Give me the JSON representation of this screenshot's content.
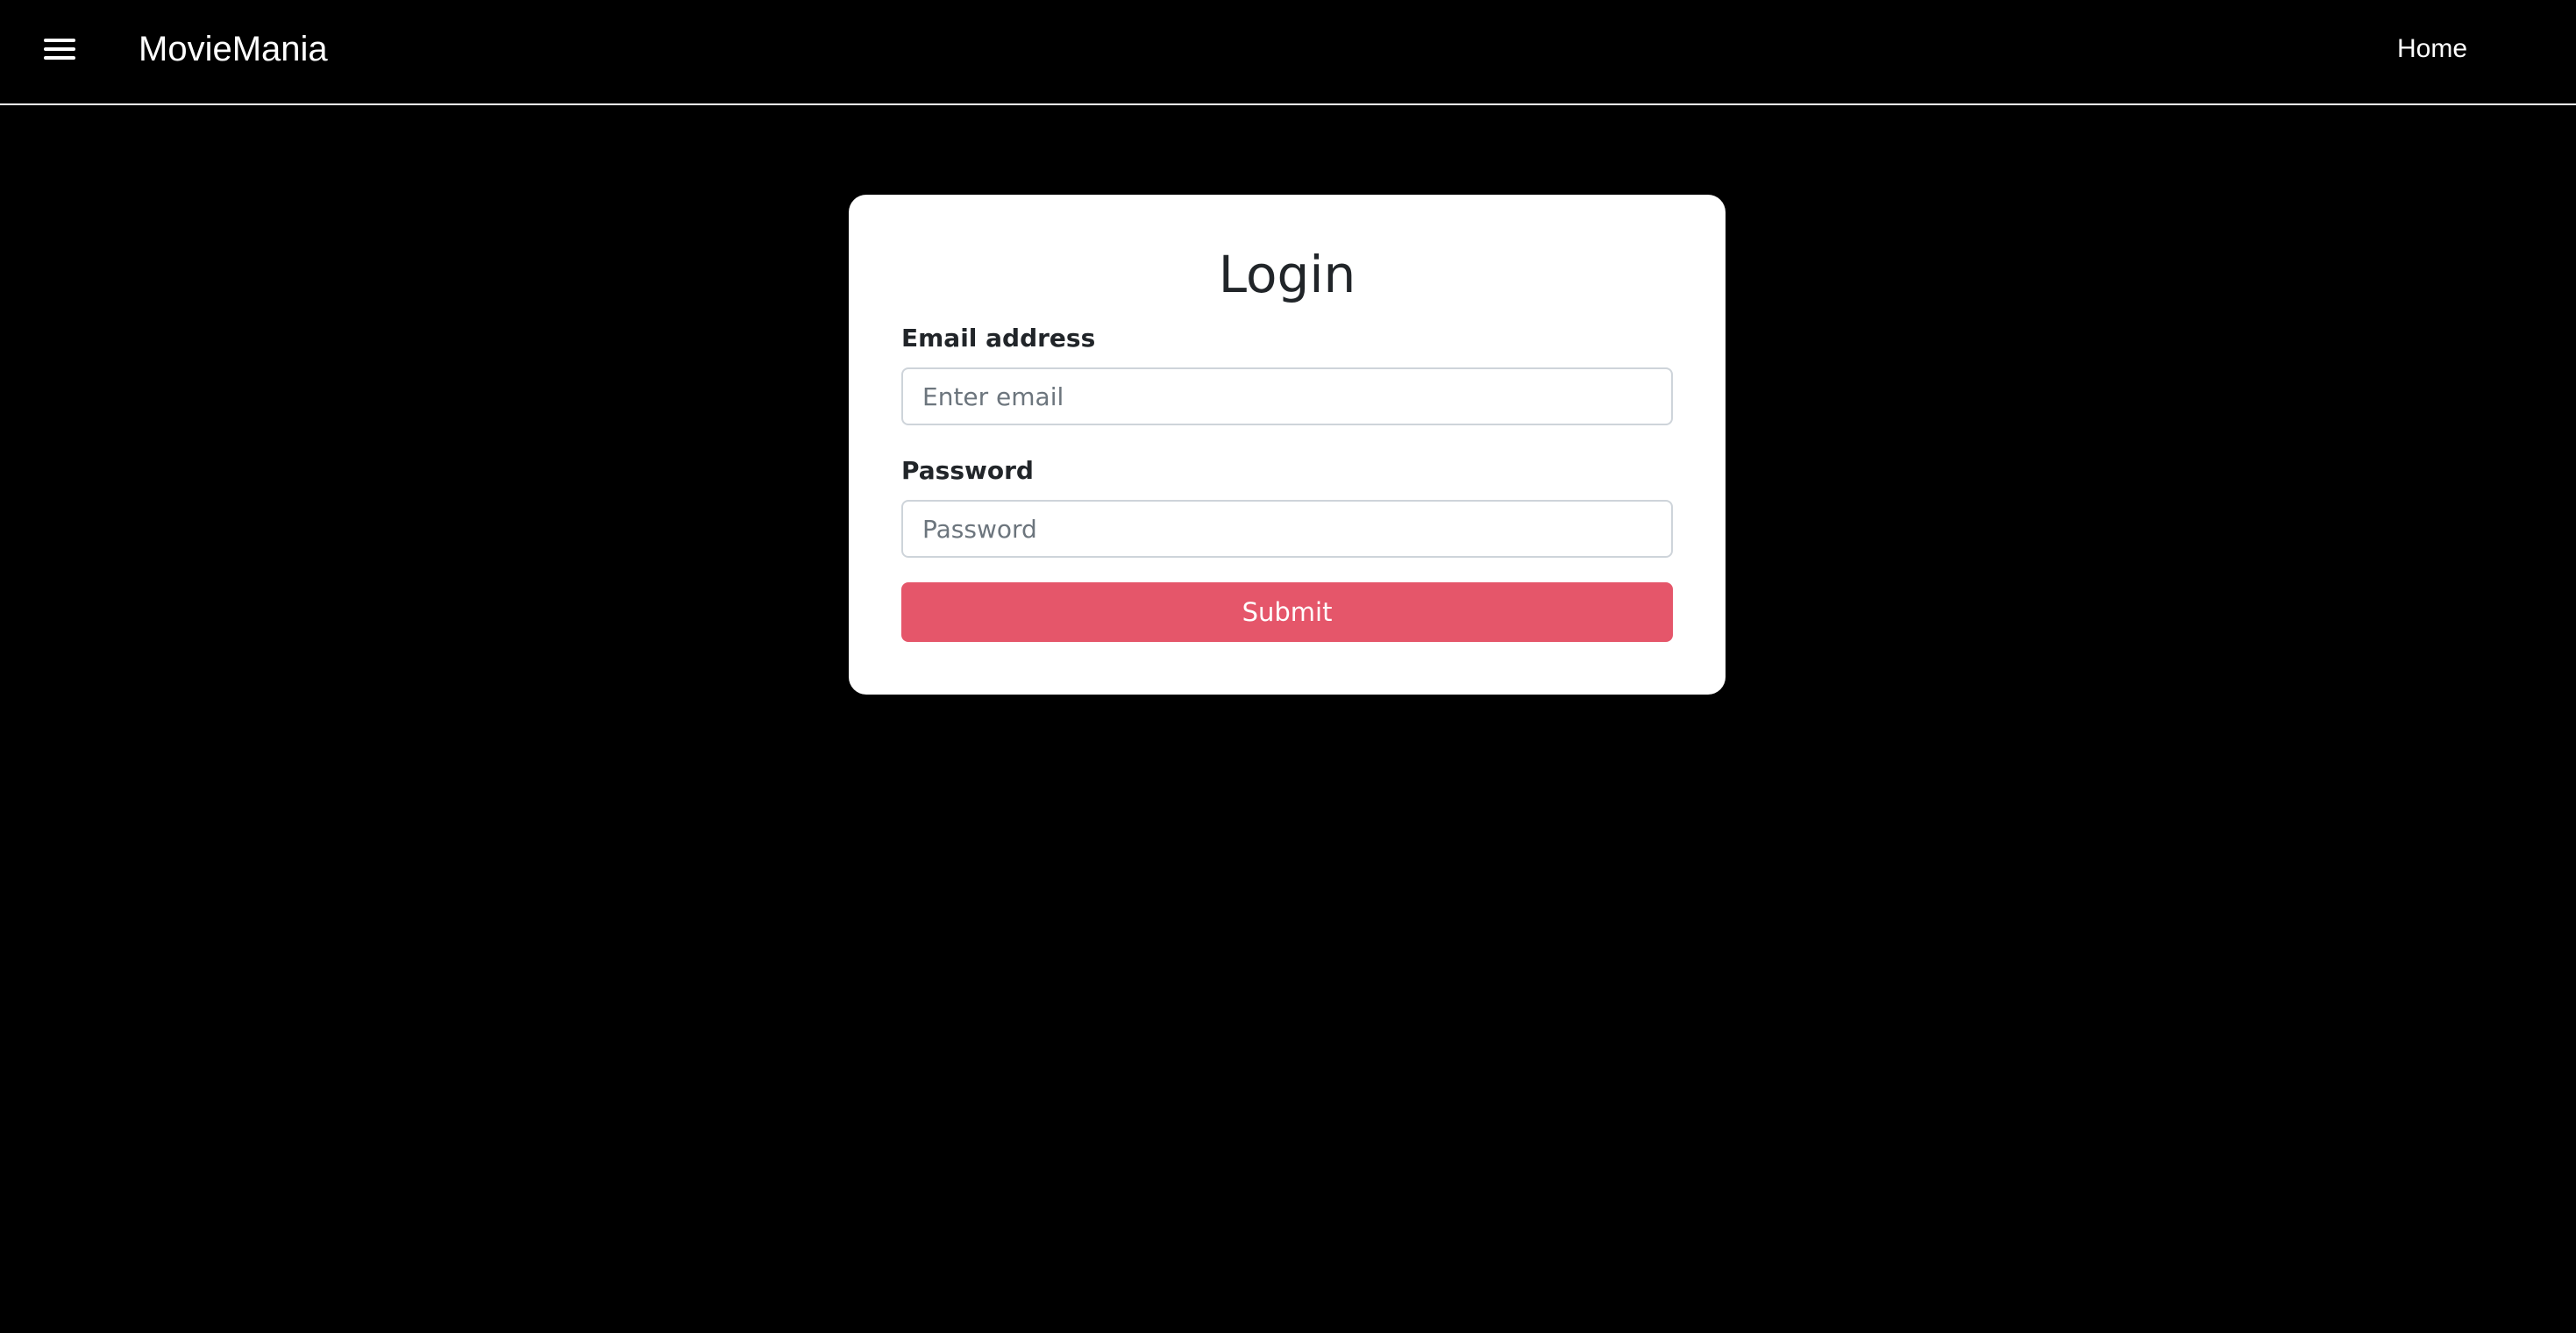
{
  "header": {
    "brand": "MovieMania",
    "menu_icon": "hamburger-menu-icon",
    "nav_home": "Home"
  },
  "login": {
    "title": "Login",
    "email_label": "Email address",
    "email_placeholder": "Enter email",
    "email_value": "",
    "password_label": "Password",
    "password_placeholder": "Password",
    "password_value": "",
    "submit_label": "Submit"
  },
  "colors": {
    "background": "#000000",
    "card": "#ffffff",
    "submit_button": "#e5566a",
    "text_dark": "#212529"
  }
}
